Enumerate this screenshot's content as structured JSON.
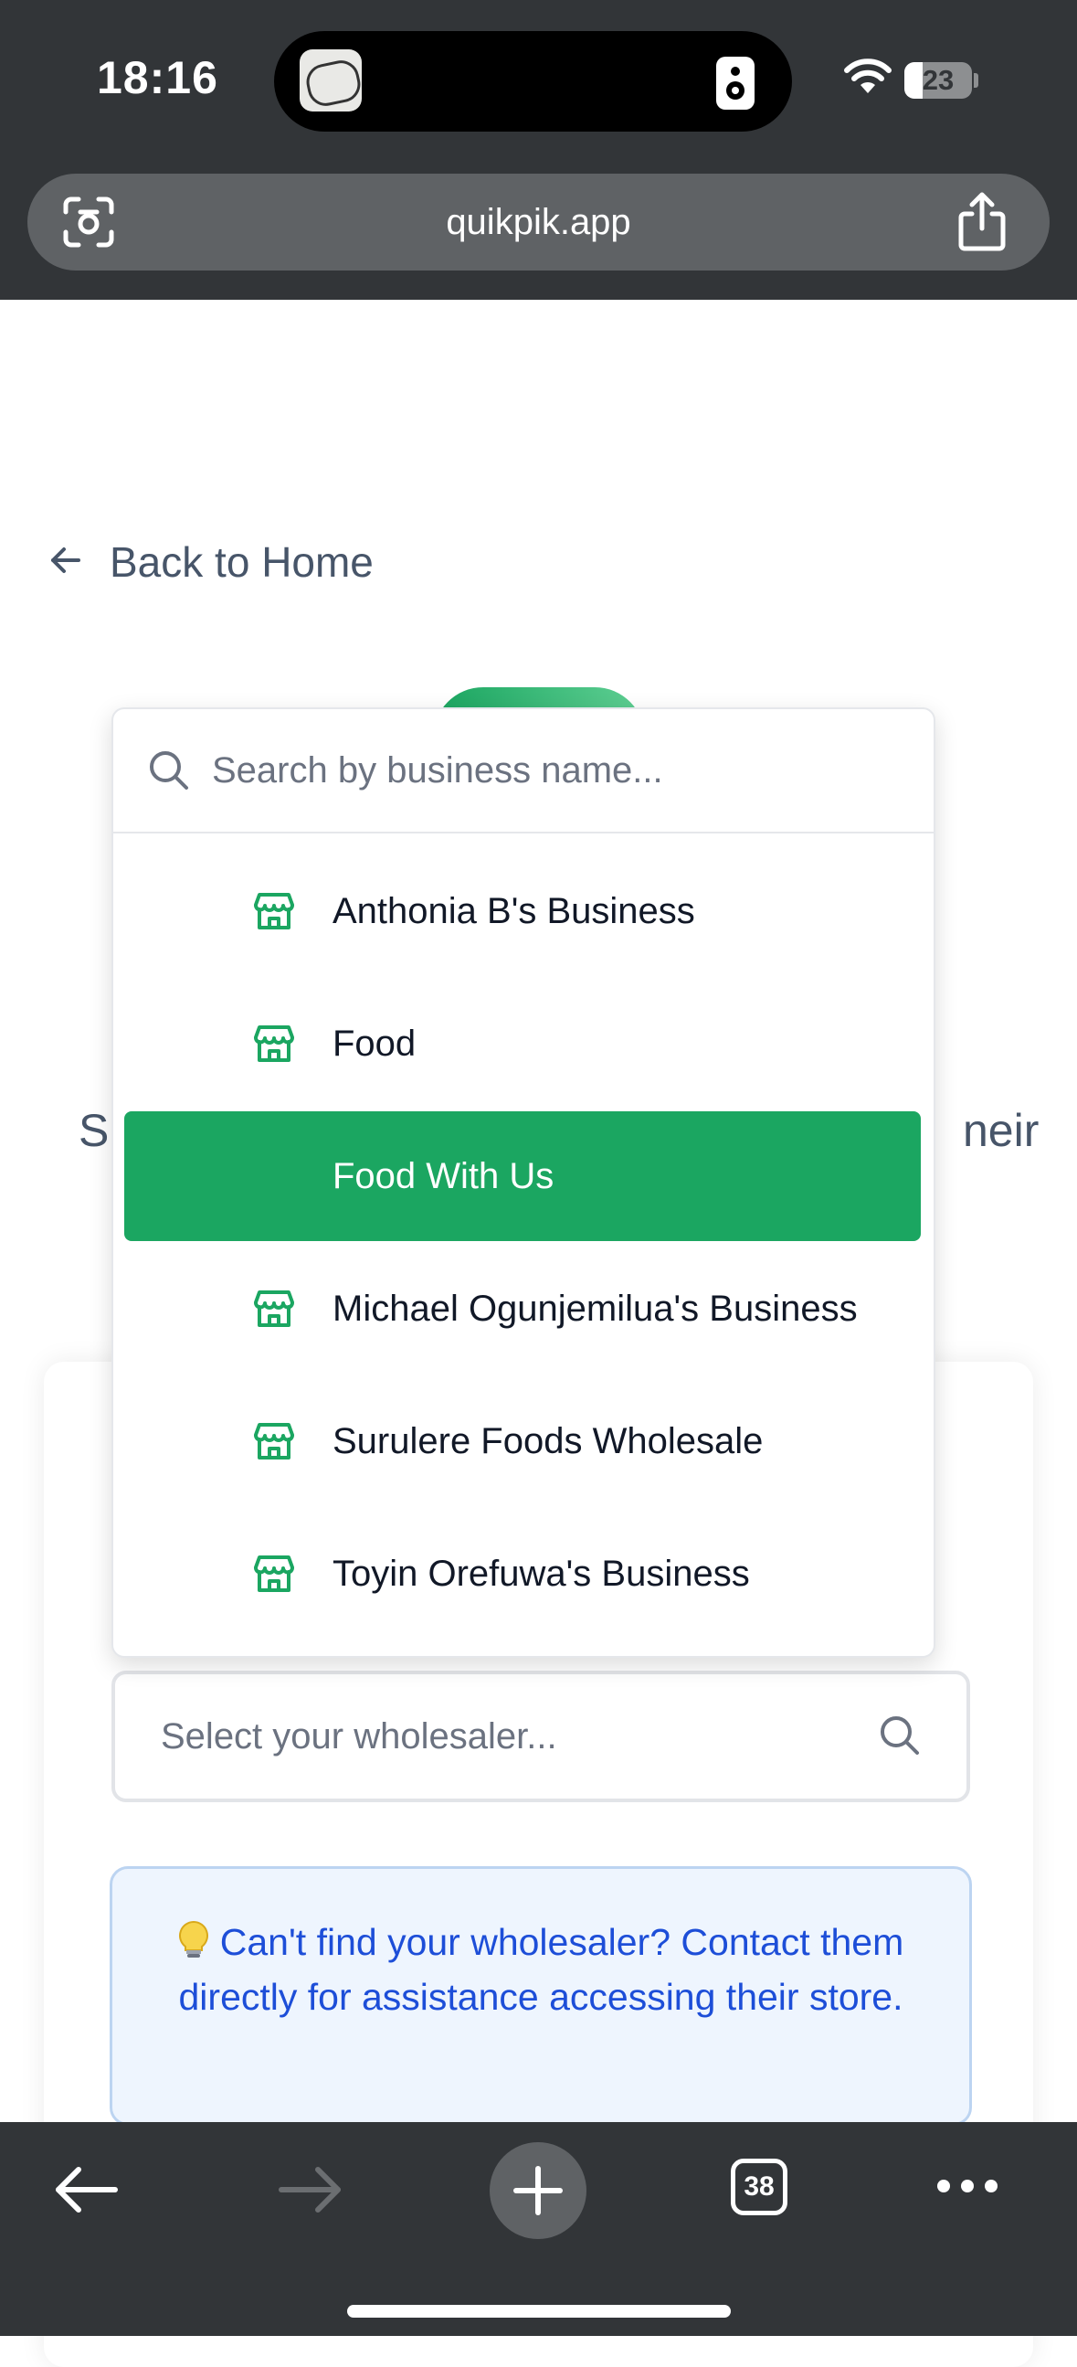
{
  "status_bar": {
    "time": "18:16",
    "battery": "23"
  },
  "browser": {
    "url": "quikpik.app",
    "tab_count": "38"
  },
  "page": {
    "back_link": "Back to Home",
    "partial_heading_left": "S",
    "partial_heading_right": "neir",
    "select_placeholder": "Select your wholesaler...",
    "info_text": "Can't find your wholesaler? Contact them directly for assistance accessing their store."
  },
  "dropdown": {
    "search_placeholder": "Search by business name...",
    "items": [
      {
        "label": "Anthonia B's Business",
        "icon": "store-icon",
        "selected": false
      },
      {
        "label": "Food",
        "icon": "store-icon",
        "selected": false
      },
      {
        "label": "Food With Us",
        "icon": "store-icon",
        "selected": true
      },
      {
        "label": "Michael Ogunjemilua's Business",
        "icon": "store-icon",
        "selected": false
      },
      {
        "label": "Surulere Foods Wholesale",
        "icon": "store-icon",
        "selected": false
      },
      {
        "label": "Toyin Orefuwa's Business",
        "icon": "store-icon",
        "selected": false
      }
    ]
  },
  "colors": {
    "accent_green": "#1ba661",
    "chrome_dark": "#323538",
    "info_blue": "#1d4ed8"
  }
}
